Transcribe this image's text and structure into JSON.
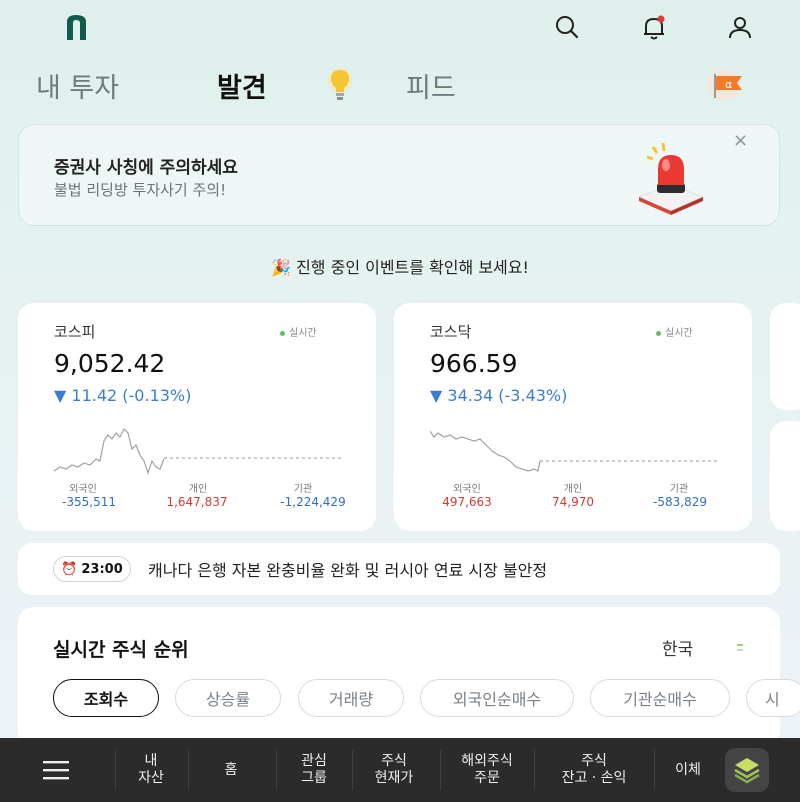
{
  "header": {
    "icons": [
      "logo-icon",
      "search-icon",
      "bell-icon",
      "user-icon"
    ]
  },
  "tabs": [
    {
      "label": "내 투자",
      "active": false
    },
    {
      "label": "발견",
      "active": true
    },
    {
      "label": "피드",
      "active": false
    }
  ],
  "banner": {
    "title": "증권사 사칭에 주의하세요",
    "subtitle": "불법 리딩방 투자사기 주의!",
    "close": "×"
  },
  "event": {
    "text": "🎉 진행 중인 이벤트를 확인해 보세요!"
  },
  "indices": [
    {
      "name": "코스피",
      "live": "실시간",
      "value": "9,052.42",
      "change": "▼  11.42 (-0.13%)",
      "flows": [
        {
          "label": "외국인",
          "value": "-355,511",
          "sign": "neg"
        },
        {
          "label": "개인",
          "value": "1,647,837",
          "sign": "pos"
        },
        {
          "label": "기관",
          "value": "-1,224,429",
          "sign": "neg"
        }
      ]
    },
    {
      "name": "코스닥",
      "live": "실시간",
      "value": "966.59",
      "change": "▼  34.34 (-3.43%)",
      "flows": [
        {
          "label": "외국인",
          "value": "497,663",
          "sign": "pos"
        },
        {
          "label": "개인",
          "value": "74,970",
          "sign": "pos"
        },
        {
          "label": "기관",
          "value": "-583,829",
          "sign": "neg"
        }
      ]
    }
  ],
  "news": {
    "time": "23:00",
    "text": "캐나다 은행 자본 완충비율 완화 및 러시아 연료 시장 불안정"
  },
  "ranking": {
    "title": "실시간 주식 순위",
    "country": "한국",
    "chips": [
      "조회수",
      "상승률",
      "거래량",
      "외국인순매수",
      "기관순매수",
      "시"
    ],
    "selected": 0
  },
  "bottom_nav": {
    "items": [
      {
        "line1": "내",
        "line2": "자산"
      },
      {
        "line1": "홈",
        "line2": ""
      },
      {
        "line1": "관심",
        "line2": "그룹"
      },
      {
        "line1": "주식",
        "line2": "현재가"
      },
      {
        "line1": "해외주식",
        "line2": "주문"
      },
      {
        "line1": "주식",
        "line2": "잔고 · 손익"
      },
      {
        "line1": "이체",
        "line2": ""
      }
    ]
  },
  "colors": {
    "up": "#d23b36",
    "down": "#2f6fc4",
    "accent": "#0f5b4d"
  }
}
